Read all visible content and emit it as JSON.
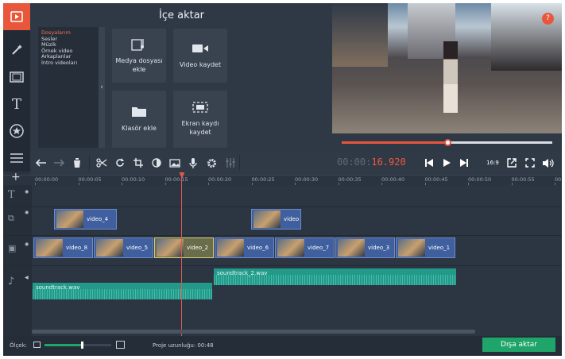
{
  "import": {
    "title": "İçe aktar",
    "categories": [
      "Dosyalarım",
      "Sesler",
      "Müzik",
      "Örnek video",
      "Arkaplanlar",
      "İntro videoları"
    ],
    "tiles": [
      {
        "label": "Medya dosyası ekle"
      },
      {
        "label": "Video kaydet"
      },
      {
        "label": "Klasör ekle"
      },
      {
        "label": "Ekran kaydı kaydet"
      }
    ]
  },
  "player": {
    "progress": 0.5,
    "time_main": "00:00:",
    "time_accent": "16.920",
    "aspect": "16:9",
    "help": "?"
  },
  "ruler": {
    "ticks": [
      "00:00:00",
      "00:00:05",
      "00:00:10",
      "00:00:15",
      "00:00:20",
      "00:00:25",
      "00:00:30",
      "00:00:35",
      "00:00:40",
      "00:00:45",
      "00:00:50",
      "00:00:55",
      "00:01"
    ]
  },
  "timeline": {
    "overlay_clips": [
      "video_4",
      "video"
    ],
    "main_clips": [
      "video_8",
      "video_5",
      "video_2",
      "video_6",
      "video_7",
      "video_3",
      "video_1"
    ],
    "audio_clips": [
      "soundtrack.wav",
      "soundtrack_2.wav"
    ],
    "playhead_seconds": 16.92
  },
  "footer": {
    "scale_label": "Ölçek:",
    "zoom": 0.55,
    "project_length_label": "Proje uzunluğu:",
    "project_length": "00:48",
    "export_label": "Dışa aktar"
  },
  "colors": {
    "accent": "#f05a3a",
    "export": "#1fa56a",
    "clip": "#3f5f9e",
    "audio": "#23998a",
    "playhead": "#e05a4b"
  }
}
